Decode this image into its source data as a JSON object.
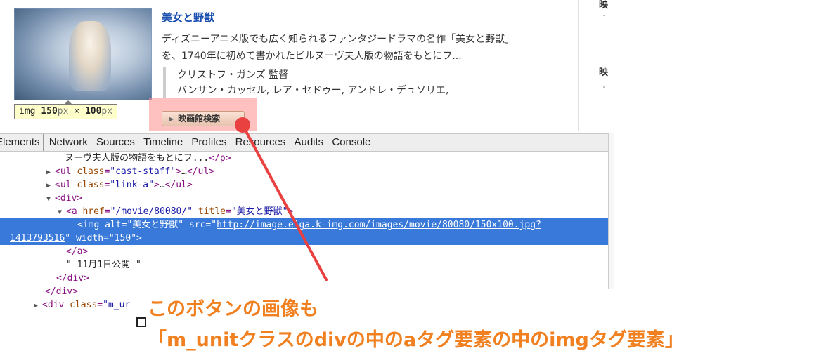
{
  "movie": {
    "title": "美女と野獣",
    "desc_line1": "ディズニーアニメ版でも広く知られるファンタジードラマの名作「美女と野獣」",
    "desc_line2": "を、1740年に初めて書かれたビルヌーヴ夫人版の物語をもとにフ...",
    "director": "クリストフ・ガンズ 監督",
    "cast": "バンサン・カッセル, レア・セドゥー, アンドレ・デュソリエ,",
    "search_button": "映画館検索"
  },
  "size_tooltip": {
    "tag": "img",
    "width": "150",
    "unit1": "px",
    "times": " × ",
    "height": "100",
    "unit2": "px"
  },
  "sidebar": {
    "head1": "映",
    "bullet1": "・",
    "head2": "映",
    "bullet2": "・"
  },
  "devtools": {
    "tabs": [
      "Elements",
      "Network",
      "Sources",
      "Timeline",
      "Profiles",
      "Resources",
      "Audits",
      "Console"
    ],
    "lines": {
      "l1": "ヌーヴ夫人版の物語をもとにフ...",
      "l2_cls": "\"cast-staff\"",
      "l3_cls": "\"link-a\"",
      "l5_href": "\"/movie/80080/\"",
      "l5_title": "\"美女と野獣\"",
      "l6_alt": "\"美女と野獣\"",
      "l6_src": "http://image.eiga.k-img.com/images/movie/80080/150x100.jpg?",
      "l7_src": "1413793516",
      "l7_width": "\"150\"",
      "l9_text": "\" 11月1日公開 \"",
      "l12_cls": "\"m_ur"
    }
  },
  "annotation": {
    "line1": "このボタンの画像も",
    "line2": "「m_unitクラスのdivの中のaタグ要素の中のimgタグ要素」",
    "color": "#f08020"
  }
}
